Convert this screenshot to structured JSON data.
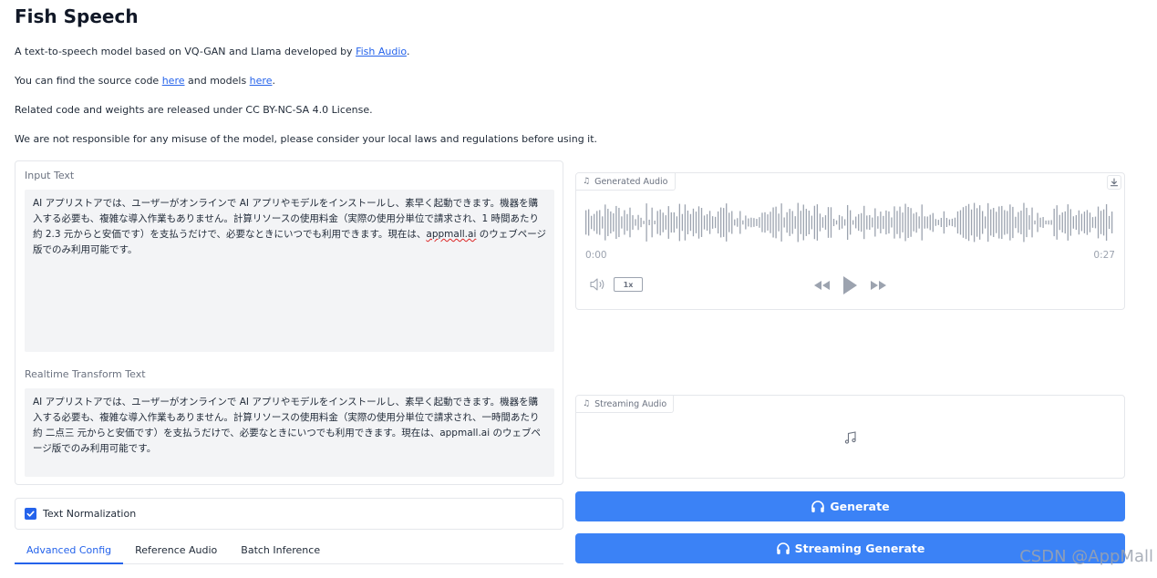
{
  "header": {
    "title": "Fish Speech",
    "description_prefix": "A text-to-speech model based on VQ-GAN and Llama developed by ",
    "description_link": "Fish Audio",
    "description_suffix": ".",
    "source_prefix": "You can find the source code ",
    "source_link": "here",
    "source_middle": " and models ",
    "models_link": "here",
    "source_suffix": ".",
    "license": "Related code and weights are released under CC BY-NC-SA 4.0 License.",
    "disclaimer": "We are not responsible for any misuse of the model, please consider your local laws and regulations before using it."
  },
  "input": {
    "label": "Input Text",
    "value_before": "AI アプリストアでは、ユーザーがオンラインで AI アプリやモデルをインストールし、素早く起動できます。機器を購入する必要も、複雑な導入作業もありません。計算リソースの使用料金（実際の使用分単位で請求され、1 時間あたり約 2.3 元からと安価です）を支払うだけで、必要なときにいつでも利用できます。現在は、",
    "value_flagged": "appmall.ai",
    "value_after": " のウェブページ版でのみ利用可能です。"
  },
  "transform": {
    "label": "Realtime Transform Text",
    "value": "AI アプリストアでは、ユーザーがオンラインで AI アプリやモデルをインストールし、素早く起動できます。機器を購入する必要も、複雑な導入作業もありません。計算リソースの使用料金（実際の使用分単位で請求され、一時間あたり約 二点三 元からと安価です）を支払うだけで、必要なときにいつでも利用できます。現在は、appmall.ai のウェブページ版でのみ利用可能です。"
  },
  "options": {
    "normalization_label": "Text Normalization",
    "normalization_checked": true
  },
  "tabs": [
    {
      "label": "Advanced Config",
      "active": true
    },
    {
      "label": "Reference Audio",
      "active": false
    },
    {
      "label": "Batch Inference",
      "active": false
    }
  ],
  "generated_audio": {
    "label": "Generated Audio",
    "current_time": "0:00",
    "duration": "0:27",
    "speed": "1x"
  },
  "streaming_audio": {
    "label": "Streaming Audio"
  },
  "buttons": {
    "generate": "Generate",
    "streaming_generate": "Streaming Generate"
  },
  "watermark": "CSDN @AppMall",
  "colors": {
    "accent": "#3b82f6",
    "link": "#2563eb"
  }
}
